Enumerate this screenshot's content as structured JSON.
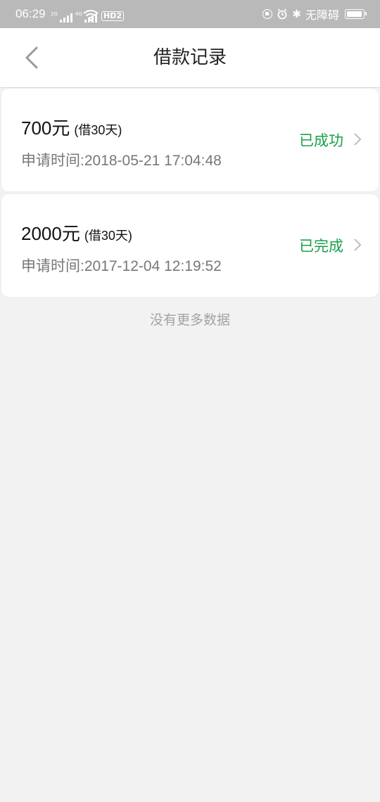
{
  "status_bar": {
    "time": "06:29",
    "signal1_tag": "2G",
    "signal2_tag": "4G",
    "hd_label": "HD2",
    "accessibility_text": "无障碍"
  },
  "header": {
    "title": "借款记录",
    "back_icon": "chevron-left-icon"
  },
  "records": [
    {
      "amount": "700元",
      "term": "(借30天)",
      "apply_time": "申请时间:2018-05-21 17:04:48",
      "status": "已成功"
    },
    {
      "amount": "2000元",
      "term": "(借30天)",
      "apply_time": "申请时间:2017-12-04 12:19:52",
      "status": "已完成"
    }
  ],
  "footer": {
    "no_more_text": "没有更多数据"
  },
  "colors": {
    "status_green": "#1aa04a",
    "background": "#f2f2f2",
    "statusbar": "#b9b9b9"
  }
}
